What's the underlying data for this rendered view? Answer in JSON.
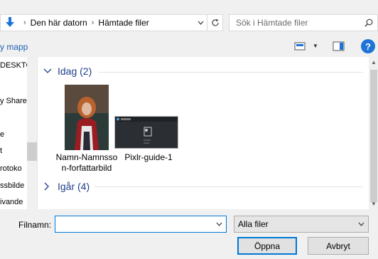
{
  "address": {
    "segments": [
      "Den här datorn",
      "Hämtade filer"
    ],
    "separator": "›"
  },
  "search": {
    "placeholder": "Sök i Hämtade filer"
  },
  "toolbar": {
    "new_folder_label": "y mapp"
  },
  "nav": {
    "items": [
      "DESKTO",
      "y Share",
      "e",
      "t",
      "rotoko",
      "ssbilde",
      "ivande"
    ]
  },
  "content": {
    "groups": [
      {
        "label": "Idag (2)",
        "files": [
          {
            "name": "Namn-Namnsson-forfattarbild",
            "line1": "Namn-Namnsso",
            "line2": "n-forfattarbild"
          },
          {
            "name": "Pixlr-guide-1",
            "line1": "Pixlr-guide-1",
            "line2": ""
          }
        ]
      },
      {
        "label": "Igår (4)"
      }
    ]
  },
  "footer": {
    "filename_label": "Filnamn:",
    "filename_value": "",
    "filter_selected": "Alla filer",
    "open_label": "Öppna",
    "cancel_label": "Avbryt"
  },
  "colors": {
    "accent": "#0078d7",
    "group_header": "#1e3e8c",
    "link": "#1e5fb4"
  }
}
